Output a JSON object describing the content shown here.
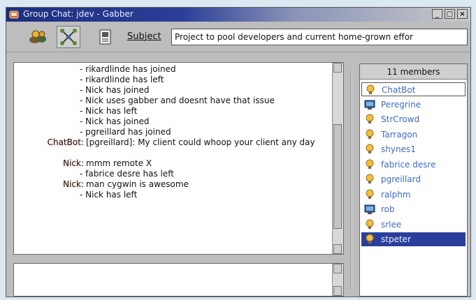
{
  "window": {
    "title": "Group Chat: ",
    "title_sep": " - ",
    "room": "jdev",
    "app": "Gabber",
    "title_buttons": [
      "_",
      "□",
      "×"
    ]
  },
  "toolbar": {
    "subject_label": "Subject",
    "subject_value": "Project to pool developers and current home-grown effor"
  },
  "chat": {
    "lines": [
      {
        "nick": "",
        "text": "- rikardlinde has joined"
      },
      {
        "nick": "",
        "text": "- rikardlinde has left"
      },
      {
        "nick": "",
        "text": "- Nick has joined"
      },
      {
        "nick": "",
        "text": "- Nick uses gabber and doesnt have that issue"
      },
      {
        "nick": "",
        "text": "- Nick has left"
      },
      {
        "nick": "",
        "text": "- Nick has joined"
      },
      {
        "nick": "",
        "text": "- pgreillard has joined"
      },
      {
        "nick": "ChatBot:",
        "text": "[pgreillard]: My client could whoop your client any day"
      },
      {
        "nick": "Nick:",
        "text": "mmm remote X"
      },
      {
        "nick": "",
        "text": "- fabrice desre has left"
      },
      {
        "nick": "Nick:",
        "text": "man cygwin is awesome"
      },
      {
        "nick": "",
        "text": "- Nick has left"
      }
    ]
  },
  "members": {
    "header": "11 members",
    "items": [
      {
        "name": "ChatBot",
        "icon": "lightbulb-icon"
      },
      {
        "name": "Peregrine",
        "icon": "computer-icon"
      },
      {
        "name": "StrCrowd",
        "icon": "lightbulb-icon"
      },
      {
        "name": "Tarragon",
        "icon": "lightbulb-icon"
      },
      {
        "name": "shynes1",
        "icon": "lightbulb-icon"
      },
      {
        "name": "fabrice desre",
        "icon": "lightbulb-icon"
      },
      {
        "name": "pgreillard",
        "icon": "lightbulb-icon"
      },
      {
        "name": "ralphm",
        "icon": "lightbulb-icon"
      },
      {
        "name": "rob",
        "icon": "computer-icon"
      },
      {
        "name": "srlee",
        "icon": "lightbulb-icon"
      },
      {
        "name": "stpeter",
        "icon": "lightbulb-icon"
      }
    ],
    "focused_index": 0,
    "selected_index": 10
  },
  "colors": {
    "accent": "#2a3f9c",
    "member_text": "#3d6ac4",
    "nick_glow": "#f2b49a"
  }
}
